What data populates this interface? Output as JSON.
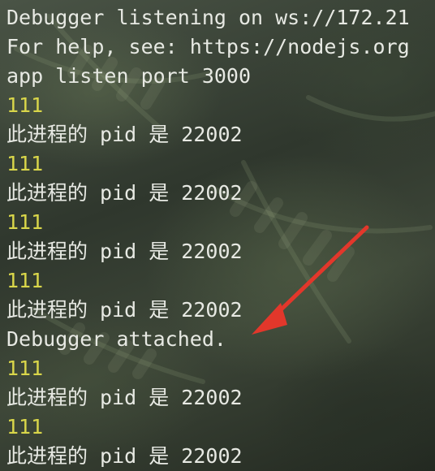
{
  "terminal": {
    "lines": [
      {
        "text": "Debugger listening on ws://172.21",
        "color": "#e7e9e3"
      },
      {
        "text": "For help, see: https://nodejs.org",
        "color": "#e7e9e3"
      },
      {
        "text": "app listen port 3000",
        "color": "#e7e9e3"
      },
      {
        "text": "111",
        "color": "#d9d64a"
      },
      {
        "text": "此进程的 pid 是 22002",
        "color": "#e7e9e3"
      },
      {
        "text": "111",
        "color": "#d9d64a"
      },
      {
        "text": "此进程的 pid 是 22002",
        "color": "#e7e9e3"
      },
      {
        "text": "111",
        "color": "#d9d64a"
      },
      {
        "text": "此进程的 pid 是 22002",
        "color": "#e7e9e3"
      },
      {
        "text": "111",
        "color": "#d9d64a"
      },
      {
        "text": "此进程的 pid 是 22002",
        "color": "#e7e9e3"
      },
      {
        "text": "Debugger attached.",
        "color": "#e7e9e3"
      },
      {
        "text": "111",
        "color": "#d9d64a"
      },
      {
        "text": "此进程的 pid 是 22002",
        "color": "#e7e9e3"
      },
      {
        "text": "111",
        "color": "#d9d64a"
      },
      {
        "text": "此进程的 pid 是 22002",
        "color": "#e7e9e3"
      }
    ]
  },
  "annotation": {
    "arrow_color": "#e2372b",
    "icon": "red-arrow-icon"
  }
}
